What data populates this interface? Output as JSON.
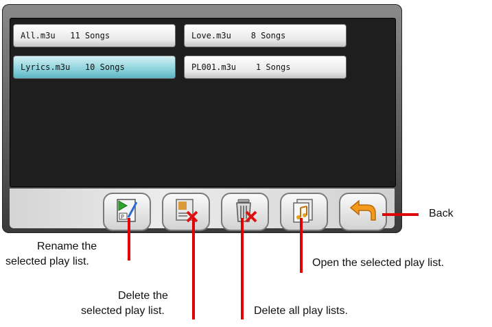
{
  "playlists": [
    {
      "name": "All.m3u",
      "count": "11 Songs",
      "label": "All.m3u   11 Songs",
      "selected": false
    },
    {
      "name": "Love.m3u",
      "count": "8 Songs",
      "label": "Love.m3u    8 Songs",
      "selected": false
    },
    {
      "name": "Lyrics.m3u",
      "count": "10 Songs",
      "label": "Lyrics.m3u   10 Songs",
      "selected": true
    },
    {
      "name": "PL001.m3u",
      "count": "1 Songs",
      "label": "PL001.m3u    1 Songs",
      "selected": false
    }
  ],
  "toolbar": {
    "buttons": [
      {
        "icon": "rename-playlist-icon"
      },
      {
        "icon": "delete-playlist-icon"
      },
      {
        "icon": "delete-all-icon"
      },
      {
        "icon": "open-playlist-icon"
      },
      {
        "icon": "back-arrow-icon"
      }
    ]
  },
  "callouts": {
    "back": "Back",
    "rename_line1": "Rename the",
    "rename_line2": "selected play list.",
    "delete_line1": "Delete the",
    "delete_line2": "selected play list.",
    "delete_all": "Delete all play lists.",
    "open": "Open the selected play list."
  },
  "colors": {
    "selected_item": "#8bd2dc",
    "callout_line": "#e00000"
  }
}
